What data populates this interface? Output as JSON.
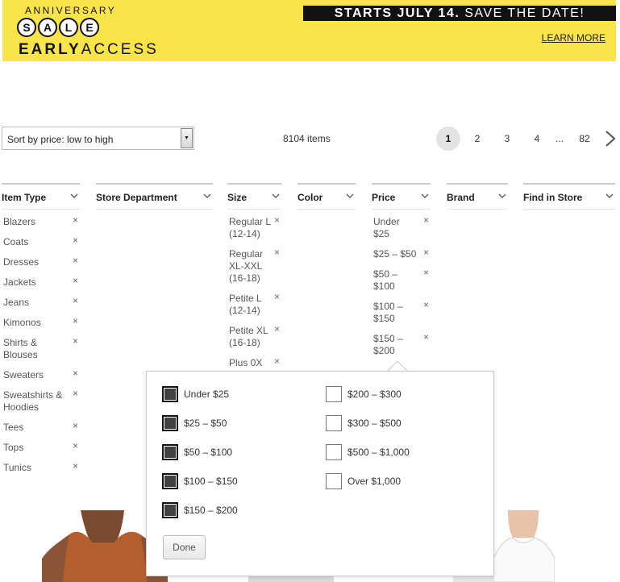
{
  "banner": {
    "anniversary": "ANNIVERSARY",
    "sale_letters": [
      "S",
      "A",
      "L",
      "E"
    ],
    "early": "EARLY",
    "access": "ACCESS",
    "starts_bold": "STARTS JULY 14.",
    "starts_rest": "SAVE THE DATE!",
    "learn_more": "LEARN MORE",
    "bg_color": "#f9e449"
  },
  "sort": {
    "label": "Sort by price: low to high"
  },
  "items_count": "8104 items",
  "pagination": {
    "pages": [
      "1",
      "2",
      "3",
      "4"
    ],
    "ellipsis": "...",
    "last": "82",
    "current": "1"
  },
  "filters": {
    "item_type": {
      "title": "Item Type",
      "items": [
        "Blazers",
        "Coats",
        "Dresses",
        "Jackets",
        "Jeans",
        "Kimonos",
        "Shirts & Blouses",
        "Sweaters",
        "Sweatshirts & Hoodies",
        "Tees",
        "Tops",
        "Tunics"
      ]
    },
    "store_department": {
      "title": "Store Department"
    },
    "size": {
      "title": "Size",
      "items": [
        "Regular L (12-14)",
        "Regular XL-XXL (16-18)",
        "Petite L (12-14)",
        "Petite XL (16-18)",
        "Plus 0X"
      ]
    },
    "color": {
      "title": "Color"
    },
    "price": {
      "title": "Price",
      "items": [
        "Under $25",
        "$25 – $50",
        "$50 – $100",
        "$100 – $150",
        "$150 – $200"
      ]
    },
    "brand": {
      "title": "Brand"
    },
    "find_in_store": {
      "title": "Find in Store"
    },
    "remove_glyph": "×"
  },
  "price_dropdown": {
    "left_options": [
      {
        "label": "Under $25",
        "checked": true
      },
      {
        "label": "$25 – $50",
        "checked": true
      },
      {
        "label": "$50 – $100",
        "checked": true
      },
      {
        "label": "$100 – $150",
        "checked": true
      },
      {
        "label": "$150 – $200",
        "checked": true
      }
    ],
    "right_options": [
      {
        "label": "$200 – $300",
        "checked": false
      },
      {
        "label": "$300 – $500",
        "checked": false
      },
      {
        "label": "$500 – $1,000",
        "checked": false
      },
      {
        "label": "Over $1,000",
        "checked": false
      }
    ],
    "done_label": "Done"
  }
}
